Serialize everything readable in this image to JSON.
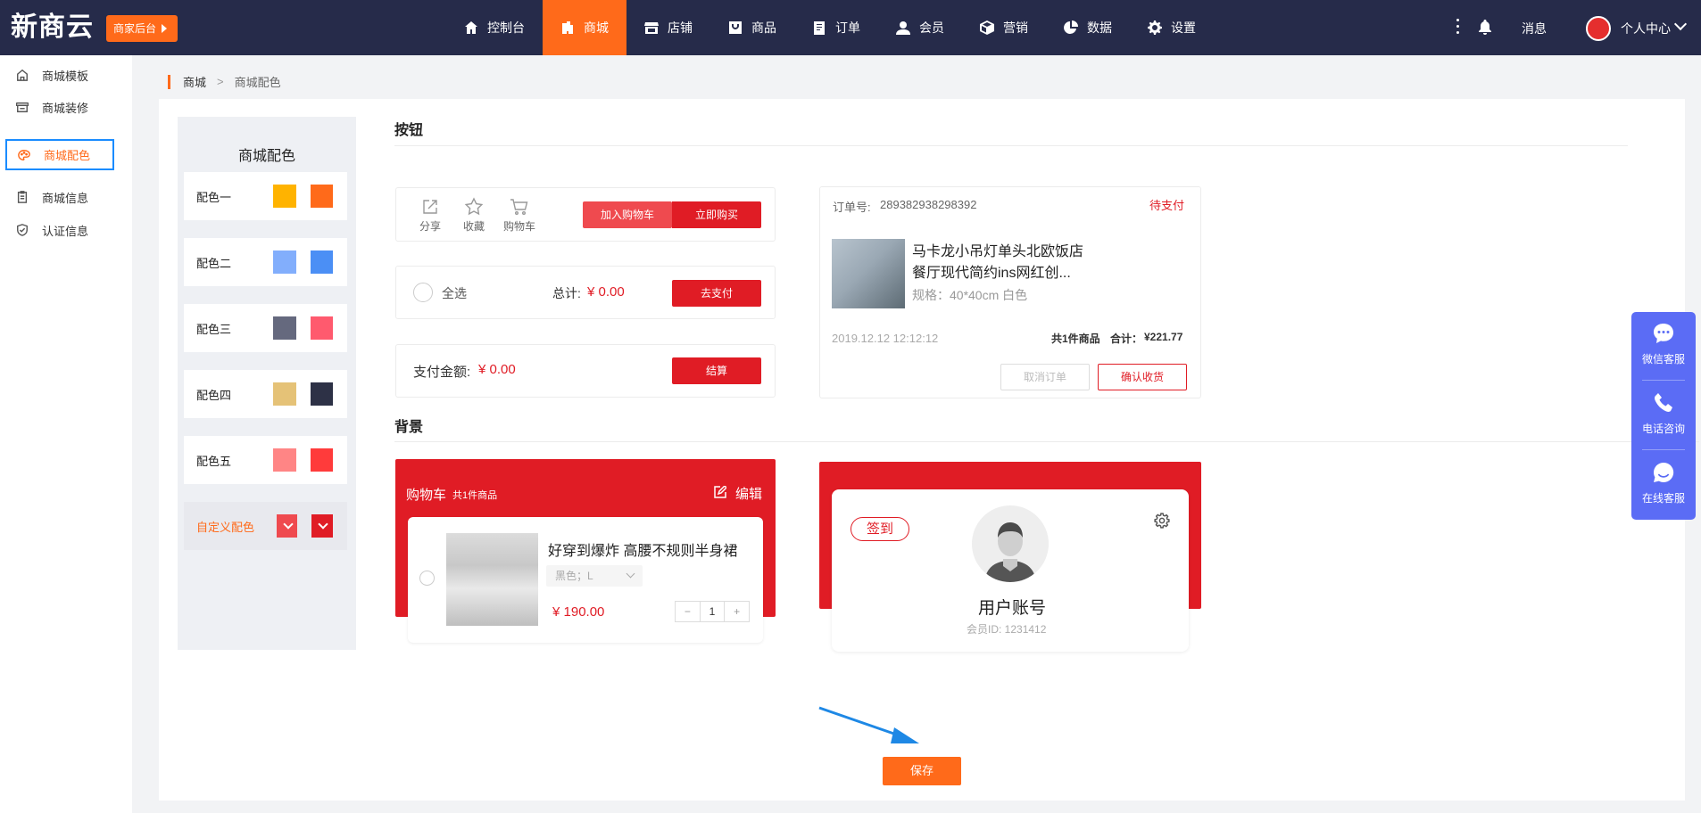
{
  "header": {
    "logo": "新商云",
    "badge": "商家后台",
    "nav": [
      {
        "label": "控制台",
        "icon": "home-icon"
      },
      {
        "label": "商城",
        "icon": "mall-icon",
        "active": true
      },
      {
        "label": "店铺",
        "icon": "store-icon"
      },
      {
        "label": "商品",
        "icon": "goods-icon"
      },
      {
        "label": "订单",
        "icon": "order-icon"
      },
      {
        "label": "会员",
        "icon": "member-icon"
      },
      {
        "label": "营销",
        "icon": "marketing-icon"
      },
      {
        "label": "数据",
        "icon": "data-icon"
      },
      {
        "label": "设置",
        "icon": "settings-icon"
      }
    ],
    "messages": "消息",
    "user_center": "个人中心"
  },
  "sidebar": {
    "items": [
      {
        "label": "商城模板",
        "icon": "home-icon"
      },
      {
        "label": "商城装修",
        "icon": "store-icon"
      },
      {
        "label": "商城配色",
        "icon": "palette-icon",
        "active": true
      },
      {
        "label": "商城信息",
        "icon": "clipboard-icon"
      },
      {
        "label": "认证信息",
        "icon": "shield-check-icon"
      }
    ]
  },
  "breadcrumb": {
    "root": "商城",
    "separator": ">",
    "current": "商城配色"
  },
  "palette": {
    "title": "商城配色",
    "schemes": [
      {
        "label": "配色一",
        "colors": [
          "#ffb300",
          "#ff6a1a"
        ]
      },
      {
        "label": "配色二",
        "colors": [
          "#82aefc",
          "#4b8ff5"
        ]
      },
      {
        "label": "配色三",
        "colors": [
          "#65697e",
          "#ff5a6e"
        ]
      },
      {
        "label": "配色四",
        "colors": [
          "#e5c277",
          "#2d3146"
        ]
      },
      {
        "label": "配色五",
        "colors": [
          "#ff8585",
          "#ff3b3b"
        ]
      }
    ],
    "custom": {
      "label": "自定义配色",
      "colors": [
        "#ef4a4f",
        "#e01c25"
      ]
    }
  },
  "buttons_section": {
    "title": "按钮",
    "product_bar": {
      "share": "分享",
      "favorite": "收藏",
      "cart": "购物车",
      "add_to_cart": "加入购物车",
      "buy_now": "立即购买"
    },
    "cart_bar": {
      "select_all": "全选",
      "total_label": "总计:",
      "total_value": "¥ 0.00",
      "pay": "去支付"
    },
    "payment_bar": {
      "label": "支付金额:",
      "value": "¥ 0.00",
      "checkout": "结算"
    },
    "order_card": {
      "order_no_label": "订单号:",
      "order_no": "289382938298392",
      "status": "待支付",
      "title_line1": "马卡龙小吊灯单头北欧饭店",
      "title_line2": "餐厅现代简约ins网红创...",
      "spec": "规格：40*40cm 白色",
      "date": "2019.12.12 12:12:12",
      "count": "共1件商品",
      "sum_label": "合计：",
      "sum_value": "¥221.77",
      "cancel": "取消订单",
      "confirm": "确认收货"
    }
  },
  "background_section": {
    "title": "背景",
    "cart_card": {
      "title": "购物车",
      "count": "共1件商品",
      "edit": "编辑",
      "item_name": "好穿到爆炸 高腰不规则半身裙",
      "spec": "黑色；L",
      "price": "¥ 190.00",
      "qty": "1",
      "minus": "−",
      "plus": "+"
    },
    "user_card": {
      "signin": "签到",
      "account": "用户账号",
      "member_id": "会员ID: 1231412"
    }
  },
  "float_service": {
    "items": [
      {
        "label": "微信客服",
        "icon": "chat-icon"
      },
      {
        "label": "电话咨询",
        "icon": "phone-icon"
      },
      {
        "label": "在线客服",
        "icon": "online-service-icon"
      }
    ],
    "color": "#5b6cf5"
  },
  "save_button": "保存",
  "colors": {
    "accent": "#ff6a1a",
    "primary_red": "#e01c25",
    "header_bg": "#262b4a",
    "selection_border": "#1a8cff"
  }
}
